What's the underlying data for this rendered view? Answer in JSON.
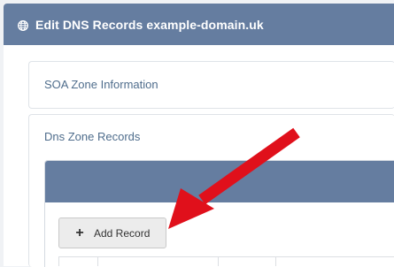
{
  "header": {
    "title": "Edit DNS Records example-domain.uk",
    "icon": "globe-icon",
    "background": "#657da0"
  },
  "soa": {
    "title": "SOA Zone Information"
  },
  "dns": {
    "title": "Dns Zone Records",
    "add_record_label": "Add Record",
    "add_icon": "plus-icon"
  },
  "colors": {
    "accent": "#657da0",
    "section_title": "#4f6d8c",
    "annotation_arrow": "#e0101b"
  }
}
